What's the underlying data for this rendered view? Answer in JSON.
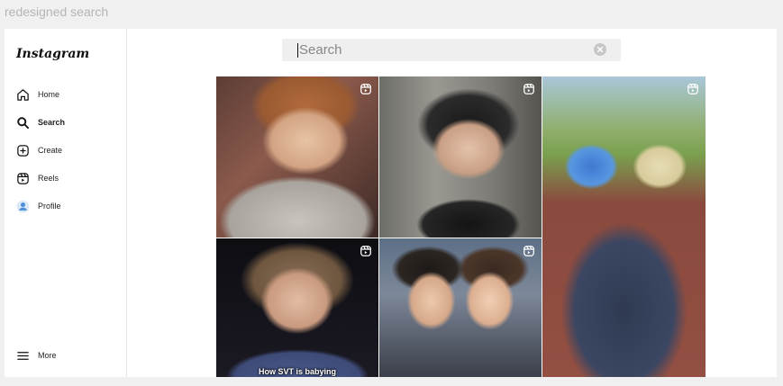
{
  "frame_title": "redesigned search",
  "app": {
    "logo": "Instagram",
    "nav": {
      "home": "Home",
      "search": "Search",
      "create": "Create",
      "reels": "Reels",
      "profile": "Profile",
      "more": "More"
    },
    "active_nav": "search"
  },
  "search": {
    "placeholder": "Search",
    "value": ""
  },
  "grid": {
    "tiles": [
      {
        "type": "reel",
        "icon": "reel-icon",
        "caption": ""
      },
      {
        "type": "reel",
        "icon": "reel-icon",
        "caption": ""
      },
      {
        "type": "reel",
        "icon": "reel-icon",
        "caption": ""
      },
      {
        "type": "reel",
        "icon": "reel-icon",
        "caption": "How SVT is babying"
      },
      {
        "type": "reel",
        "icon": "reel-icon",
        "caption": ""
      }
    ]
  },
  "colors": {
    "background": "#f0f0f0",
    "panel": "#ffffff",
    "search_bg": "#efefef",
    "text": "#222222"
  }
}
